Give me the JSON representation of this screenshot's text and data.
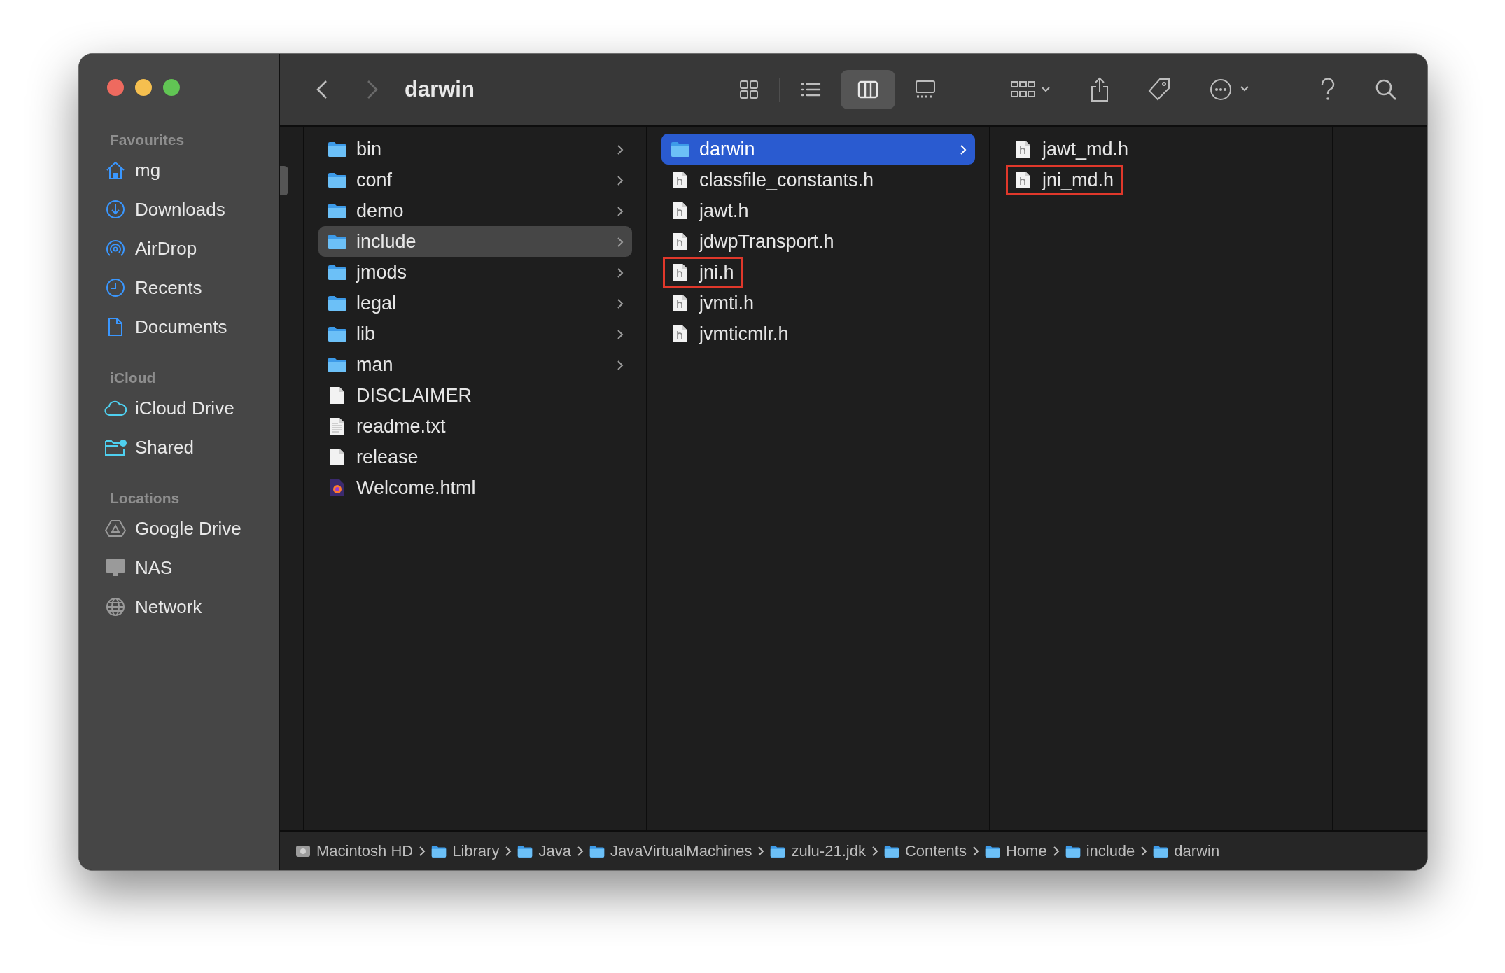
{
  "window": {
    "title": "darwin"
  },
  "toolbar": {
    "back": {
      "disabled": false
    },
    "forward": {
      "disabled": true
    },
    "views": [
      {
        "kind": "icons",
        "selected": false
      },
      {
        "kind": "list",
        "selected": false
      },
      {
        "kind": "columns",
        "selected": true
      },
      {
        "kind": "gallery",
        "selected": false
      }
    ]
  },
  "sidebar": {
    "sections": [
      {
        "title": "Favourites",
        "items": [
          {
            "label": "mg"
          },
          {
            "label": "Downloads"
          },
          {
            "label": "AirDrop"
          },
          {
            "label": "Recents"
          },
          {
            "label": "Documents"
          }
        ]
      },
      {
        "title": "iCloud",
        "items": [
          {
            "label": "iCloud Drive"
          },
          {
            "label": "Shared"
          }
        ]
      },
      {
        "title": "Locations",
        "items": [
          {
            "label": "Google Drive"
          },
          {
            "label": "NAS"
          },
          {
            "label": "Network"
          }
        ]
      }
    ]
  },
  "columns": [
    {
      "focused": false,
      "items": [
        {
          "name": "bin",
          "kind": "folder",
          "selected": false,
          "outlined": false
        },
        {
          "name": "conf",
          "kind": "folder",
          "selected": false,
          "outlined": false
        },
        {
          "name": "demo",
          "kind": "folder",
          "selected": false,
          "outlined": false
        },
        {
          "name": "include",
          "kind": "folder",
          "selected": true,
          "outlined": false
        },
        {
          "name": "jmods",
          "kind": "folder",
          "selected": false,
          "outlined": false
        },
        {
          "name": "legal",
          "kind": "folder",
          "selected": false,
          "outlined": false
        },
        {
          "name": "lib",
          "kind": "folder",
          "selected": false,
          "outlined": false
        },
        {
          "name": "man",
          "kind": "folder",
          "selected": false,
          "outlined": false
        },
        {
          "name": "DISCLAIMER",
          "kind": "document",
          "selected": false,
          "outlined": false
        },
        {
          "name": "readme.txt",
          "kind": "text",
          "selected": false,
          "outlined": false
        },
        {
          "name": "release",
          "kind": "document",
          "selected": false,
          "outlined": false
        },
        {
          "name": "Welcome.html",
          "kind": "html",
          "selected": false,
          "outlined": false
        }
      ]
    },
    {
      "focused": true,
      "items": [
        {
          "name": "darwin",
          "kind": "folder",
          "selected": true,
          "outlined": false
        },
        {
          "name": "classfile_constants.h",
          "kind": "header",
          "selected": false,
          "outlined": false
        },
        {
          "name": "jawt.h",
          "kind": "header",
          "selected": false,
          "outlined": false
        },
        {
          "name": "jdwpTransport.h",
          "kind": "header",
          "selected": false,
          "outlined": false
        },
        {
          "name": "jni.h",
          "kind": "header",
          "selected": false,
          "outlined": true
        },
        {
          "name": "jvmti.h",
          "kind": "header",
          "selected": false,
          "outlined": false
        },
        {
          "name": "jvmticmlr.h",
          "kind": "header",
          "selected": false,
          "outlined": false
        }
      ]
    },
    {
      "focused": false,
      "items": [
        {
          "name": "jawt_md.h",
          "kind": "header",
          "selected": false,
          "outlined": false
        },
        {
          "name": "jni_md.h",
          "kind": "header",
          "selected": false,
          "outlined": true
        }
      ]
    }
  ],
  "path_bar": [
    {
      "label": "Macintosh HD"
    },
    {
      "label": "Library"
    },
    {
      "label": "Java"
    },
    {
      "label": "JavaVirtualMachines"
    },
    {
      "label": "zulu-21.jdk"
    },
    {
      "label": "Contents"
    },
    {
      "label": "Home"
    },
    {
      "label": "include"
    },
    {
      "label": "darwin"
    }
  ]
}
